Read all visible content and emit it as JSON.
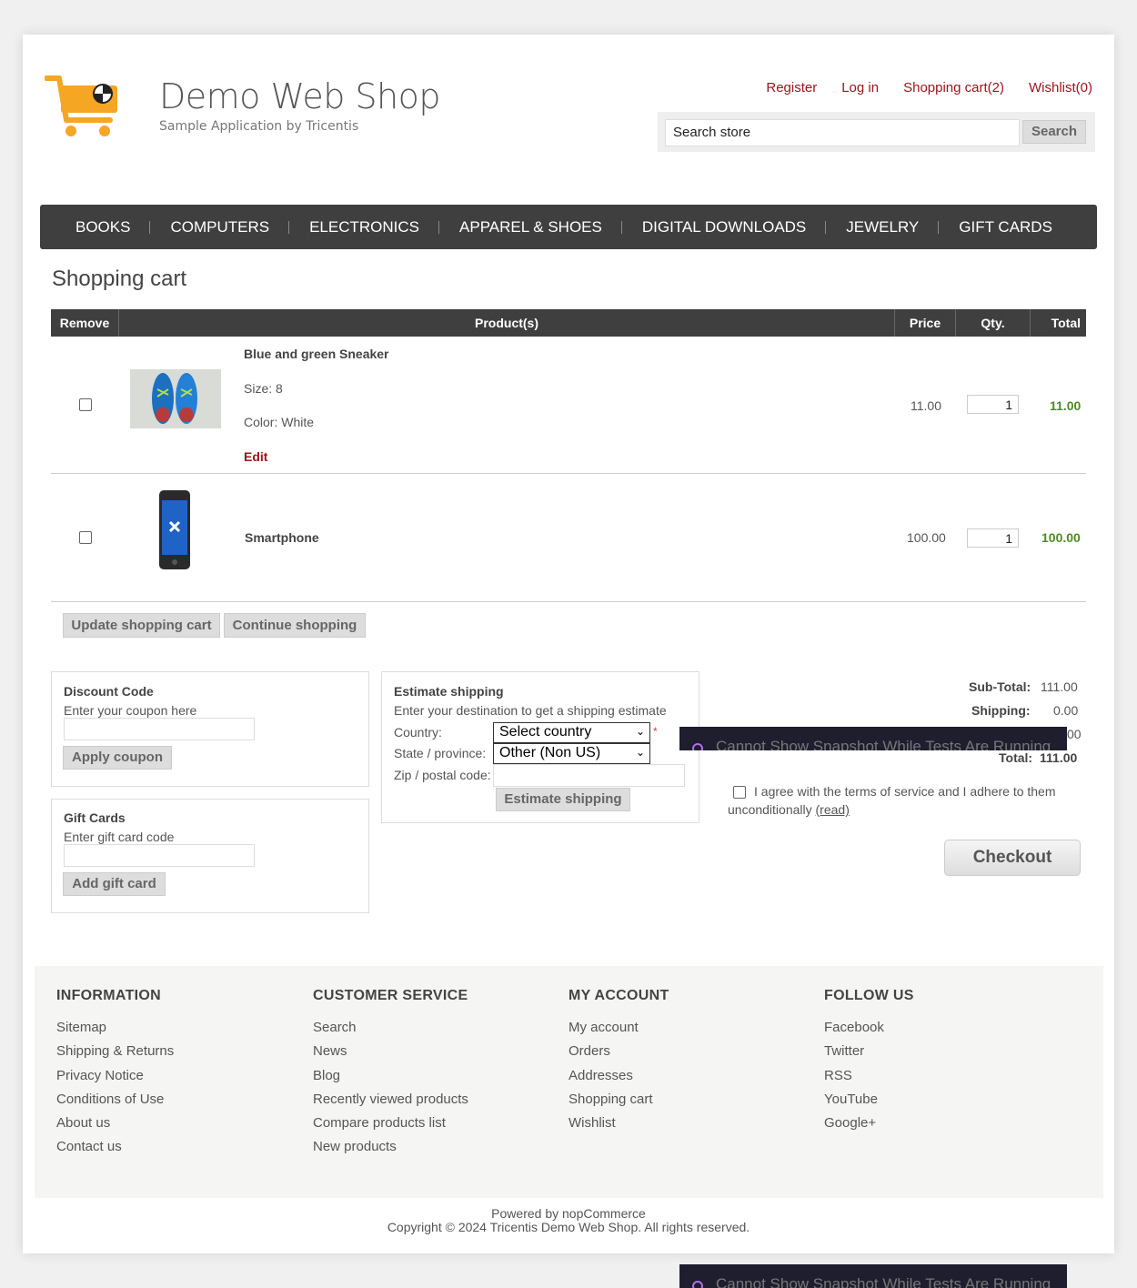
{
  "header": {
    "logo_title": "Demo Web Shop",
    "logo_subtitle": "Sample Application by Tricentis",
    "links": [
      "Register",
      "Log in",
      "Shopping cart(2)",
      "Wishlist(0)"
    ],
    "search_placeholder": "Search store",
    "search_button": "Search"
  },
  "nav": [
    "BOOKS",
    "COMPUTERS",
    "ELECTRONICS",
    "APPAREL & SHOES",
    "DIGITAL DOWNLOADS",
    "JEWELRY",
    "GIFT CARDS"
  ],
  "page_title": "Shopping cart",
  "table": {
    "headers": {
      "remove": "Remove",
      "products": "Product(s)",
      "price": "Price",
      "qty": "Qty.",
      "total": "Total"
    },
    "rows": [
      {
        "name": "Blue and green Sneaker",
        "size": "Size: 8",
        "color": "Color: White",
        "edit": "Edit",
        "price": "11.00",
        "qty": "1",
        "total": "11.00"
      },
      {
        "name": "Smartphone",
        "price": "100.00",
        "qty": "1",
        "total": "100.00"
      }
    ]
  },
  "buttons": {
    "update": "Update shopping cart",
    "continue": "Continue shopping"
  },
  "discount": {
    "title": "Discount Code",
    "hint": "Enter your coupon here",
    "button": "Apply coupon"
  },
  "giftcards": {
    "title": "Gift Cards",
    "hint": "Enter gift card code",
    "button": "Add gift card"
  },
  "shipping": {
    "title": "Estimate shipping",
    "hint": "Enter your destination to get a shipping estimate",
    "country_label": "Country:",
    "country_value": "Select country",
    "required_mark": "*",
    "state_label": "State / province:",
    "state_value": "Other (Non US)",
    "zip_label": "Zip / postal code:",
    "button": "Estimate shipping"
  },
  "totals": {
    "subtotal_label": "Sub-Total:",
    "subtotal": "111.00",
    "shipping_label": "Shipping:",
    "shipping": "0.00",
    "tax_partial": "00",
    "total_label": "Total:",
    "total": "111.00"
  },
  "overlay_text": "Cannot Show Snapshot While Tests Are Running",
  "terms": {
    "text": "I agree with the terms of service and I adhere to them unconditionally",
    "read": "(read)"
  },
  "checkout": "Checkout",
  "footer": {
    "information": {
      "title": "INFORMATION",
      "links": [
        "Sitemap",
        "Shipping & Returns",
        "Privacy Notice",
        "Conditions of Use",
        "About us",
        "Contact us"
      ]
    },
    "customer_service": {
      "title": "CUSTOMER SERVICE",
      "links": [
        "Search",
        "News",
        "Blog",
        "Recently viewed products",
        "Compare products list",
        "New products"
      ]
    },
    "my_account": {
      "title": "MY ACCOUNT",
      "links": [
        "My account",
        "Orders",
        "Addresses",
        "Shopping cart",
        "Wishlist"
      ]
    },
    "follow_us": {
      "title": "FOLLOW US",
      "links": [
        "Facebook",
        "Twitter",
        "RSS",
        "YouTube",
        "Google+"
      ]
    },
    "powered": "Powered by nopCommerce",
    "copyright": "Copyright © 2024 Tricentis Demo Web Shop. All rights reserved."
  },
  "colors": {
    "accent": "#a0141b",
    "nav_bg": "#3f3f3f",
    "total_green": "#4d8c1f",
    "logo_orange": "#f5a623"
  }
}
